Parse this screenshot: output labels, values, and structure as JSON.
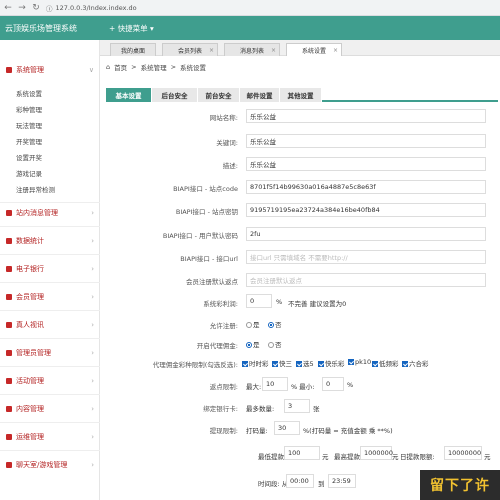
{
  "browser": {
    "url": "127.0.0.3/Index.index.do"
  },
  "header": {
    "title": "云顶娱乐场管理系统",
    "quick_menu": "+ 快捷菜单 ▾"
  },
  "sidebar": {
    "sections": [
      {
        "label": "系统管理",
        "sub": [
          "系统设置",
          "彩种管理",
          "玩法管理",
          "开奖管理",
          "设置开奖",
          "游戏记录",
          "注册异常检测"
        ]
      },
      {
        "label": "站内消息管理"
      },
      {
        "label": "数据统计"
      },
      {
        "label": "电子银行"
      },
      {
        "label": "会员管理"
      },
      {
        "label": "真人视讯"
      },
      {
        "label": "管理员管理"
      },
      {
        "label": "活动管理"
      },
      {
        "label": "内容管理"
      },
      {
        "label": "运维管理"
      },
      {
        "label": "聊天室/游戏管理"
      }
    ]
  },
  "tabs": [
    "我的桌面",
    "会员列表",
    "消息列表",
    "系统设置"
  ],
  "breadcrumb": {
    "home": "首页",
    "sep": ">",
    "level1": "系统管理",
    "level2": "系统设置"
  },
  "subtabs": [
    "基本设置",
    "后台安全",
    "前台安全",
    "邮件设置",
    "其他设置"
  ],
  "form": {
    "site_name": {
      "label": "网站名称:",
      "value": "乐乐公益"
    },
    "keywords": {
      "label": "关键词:",
      "value": "乐乐公益"
    },
    "description": {
      "label": "描述:",
      "value": "乐乐公益"
    },
    "biapi_code": {
      "label": "BIAPI接口 - 站点code",
      "value": "8701f5f14b99630a016a4887e5c8e63f"
    },
    "biapi_key": {
      "label": "BIAPI接口 - 站点密钥",
      "value": "9195719195ea23724a384e16be40fb84"
    },
    "biapi_pwd": {
      "label": "BIAPI接口 - 用户默认密码",
      "value": "2fu"
    },
    "biapi_url": {
      "label": "BIAPI接口 - 接口url",
      "placeholder": "接口url 只需填域名 不需要http://"
    },
    "default_reg": {
      "label": "会员注册默认返点",
      "placeholder": "会员注册默认返点"
    },
    "profit_rate": {
      "label": "系统彩利润:",
      "value": "0",
      "unit": "%",
      "note": "不完善 建议设置为0"
    },
    "allow_reg": {
      "label": "允许注册:",
      "opt_yes": "是",
      "opt_no": "否"
    },
    "open_agent": {
      "label": "开启代理佣金:",
      "opt_yes": "是",
      "opt_no": "否"
    },
    "agent_limit": {
      "label": "代理佣金彩种限制(勾选反选):",
      "options": [
        "时时彩",
        "快三",
        "选5",
        "快乐彩",
        "pk10",
        "低频彩",
        "六合彩"
      ]
    },
    "rebate_limit": {
      "label": "返点限制:",
      "max_label": "最大:",
      "max_value": "10",
      "min_label": "% 最小:",
      "min_value": "0",
      "unit": "%"
    },
    "bind_card": {
      "label": "绑定银行卡:",
      "max_label": "最多数量:",
      "max_value": "3",
      "unit": "张"
    },
    "withdraw_limit": {
      "label": "提现限制:",
      "code_label": "打码量:",
      "code_value": "30",
      "code_note": "%(打码量 = 充值金额 乘 **%)",
      "min_label": "最低提款:",
      "min_value": "100",
      "min_unit": "元",
      "max_label": "最高提款:",
      "max_value": "1000000",
      "max_unit": "元",
      "daily_label": "日提款限额:",
      "daily_value": "10000000",
      "daily_unit": "元",
      "time_label": "时间段: 从",
      "time_from": "00:00",
      "time_to_label": "到",
      "time_to": "23:59"
    }
  },
  "watermark": "留下了许"
}
